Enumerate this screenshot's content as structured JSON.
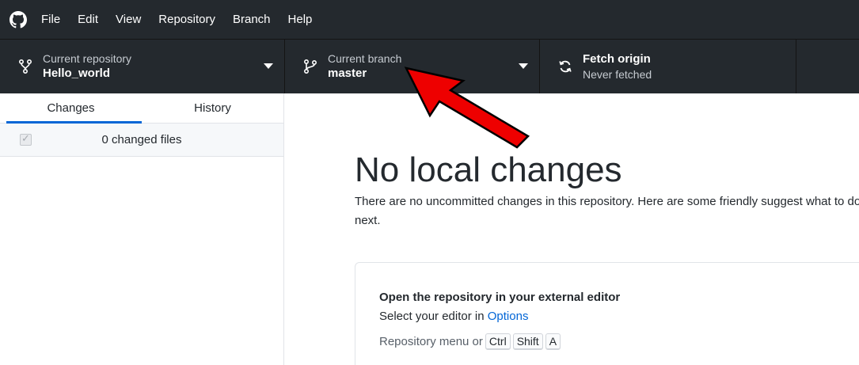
{
  "menubar": {
    "logo_icon": "github-mark-icon",
    "items": [
      "File",
      "Edit",
      "View",
      "Repository",
      "Branch",
      "Help"
    ]
  },
  "toolbar": {
    "repository": {
      "label": "Current repository",
      "value": "Hello_world",
      "icon": "repo-icon"
    },
    "branch": {
      "label": "Current branch",
      "value": "master",
      "icon": "git-branch-icon"
    },
    "fetch": {
      "label": "Fetch origin",
      "status": "Never fetched",
      "icon": "sync-icon"
    }
  },
  "sidebar": {
    "tabs": [
      {
        "label": "Changes",
        "selected": true
      },
      {
        "label": "History",
        "selected": false
      }
    ],
    "changed_files": "0 changed files"
  },
  "main": {
    "title": "No local changes",
    "description": "There are no uncommitted changes in this repository. Here are some friendly suggest what to do next.",
    "action": {
      "title": "Open the repository in your external editor",
      "desc_prefix": "Select your editor in ",
      "desc_link": "Options",
      "shortcut_prefix": "Repository menu or",
      "keys": [
        "Ctrl",
        "Shift",
        "A"
      ]
    }
  },
  "colors": {
    "toolbar_bg": "#24292e",
    "accent_blue": "#0366d6",
    "annotation_red": "#ee0000"
  }
}
